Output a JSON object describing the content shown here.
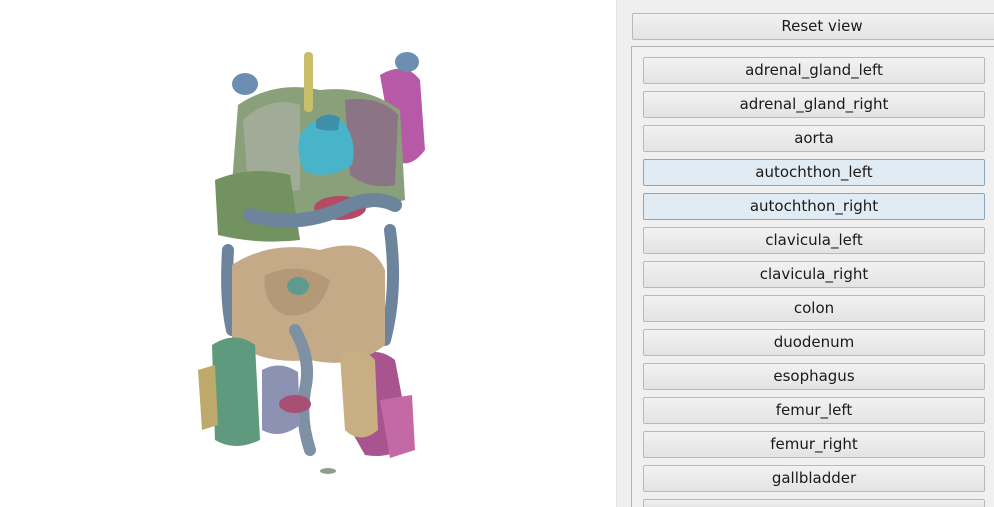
{
  "viewer": {
    "scene": "3d-segmentation-render"
  },
  "panel": {
    "reset_label": "Reset view",
    "items": [
      {
        "label": "adrenal_gland_left",
        "state": "normal"
      },
      {
        "label": "adrenal_gland_right",
        "state": "normal"
      },
      {
        "label": "aorta",
        "state": "normal"
      },
      {
        "label": "autochthon_left",
        "state": "selected"
      },
      {
        "label": "autochthon_right",
        "state": "selected"
      },
      {
        "label": "clavicula_left",
        "state": "normal"
      },
      {
        "label": "clavicula_right",
        "state": "normal"
      },
      {
        "label": "colon",
        "state": "normal"
      },
      {
        "label": "duodenum",
        "state": "normal"
      },
      {
        "label": "esophagus",
        "state": "normal"
      },
      {
        "label": "femur_left",
        "state": "normal"
      },
      {
        "label": "femur_right",
        "state": "normal"
      },
      {
        "label": "gallbladder",
        "state": "normal"
      },
      {
        "label": "",
        "state": "partial"
      }
    ]
  },
  "colors": {
    "panel_bg": "#efefef",
    "selected_bg": "#e1ebf4",
    "selected_border": "#8ca6c1"
  }
}
